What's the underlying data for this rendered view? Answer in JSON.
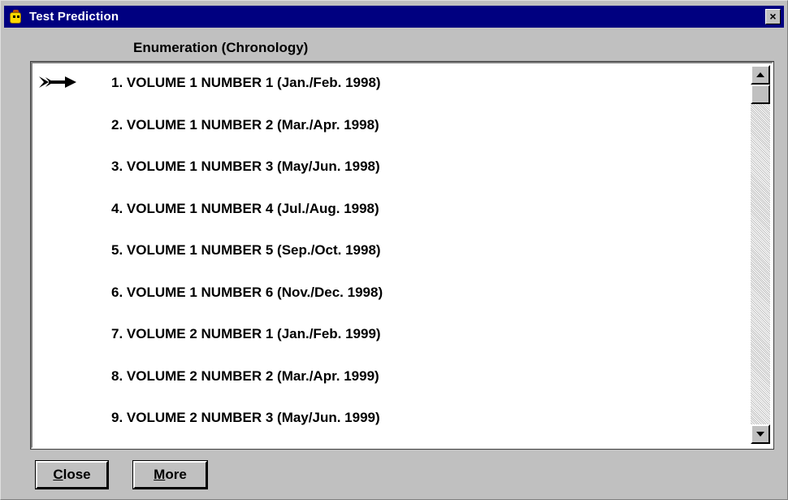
{
  "window": {
    "title": "Test Prediction",
    "close_glyph": "×",
    "title_bar_color": "#000080",
    "background_color": "#c0c0c0"
  },
  "list": {
    "column_header": "Enumeration (Chronology)",
    "current_marker_icon": "arrow-pointer-icon",
    "selected_index": 0,
    "items": [
      "1. VOLUME 1 NUMBER 1 (Jan./Feb. 1998)",
      "2. VOLUME 1 NUMBER 2 (Mar./Apr. 1998)",
      "3. VOLUME 1 NUMBER 3 (May/Jun. 1998)",
      "4. VOLUME 1 NUMBER 4 (Jul./Aug. 1998)",
      "5. VOLUME 1 NUMBER 5 (Sep./Oct. 1998)",
      "6. VOLUME 1 NUMBER 6 (Nov./Dec. 1998)",
      "7. VOLUME 2 NUMBER 1 (Jan./Feb. 1999)",
      "8. VOLUME 2 NUMBER 2 (Mar./Apr. 1999)",
      "9. VOLUME 2 NUMBER 3 (May/Jun. 1999)"
    ]
  },
  "buttons": {
    "close": {
      "mnemonic": "C",
      "rest": "lose"
    },
    "more": {
      "mnemonic": "M",
      "rest": "ore"
    }
  }
}
